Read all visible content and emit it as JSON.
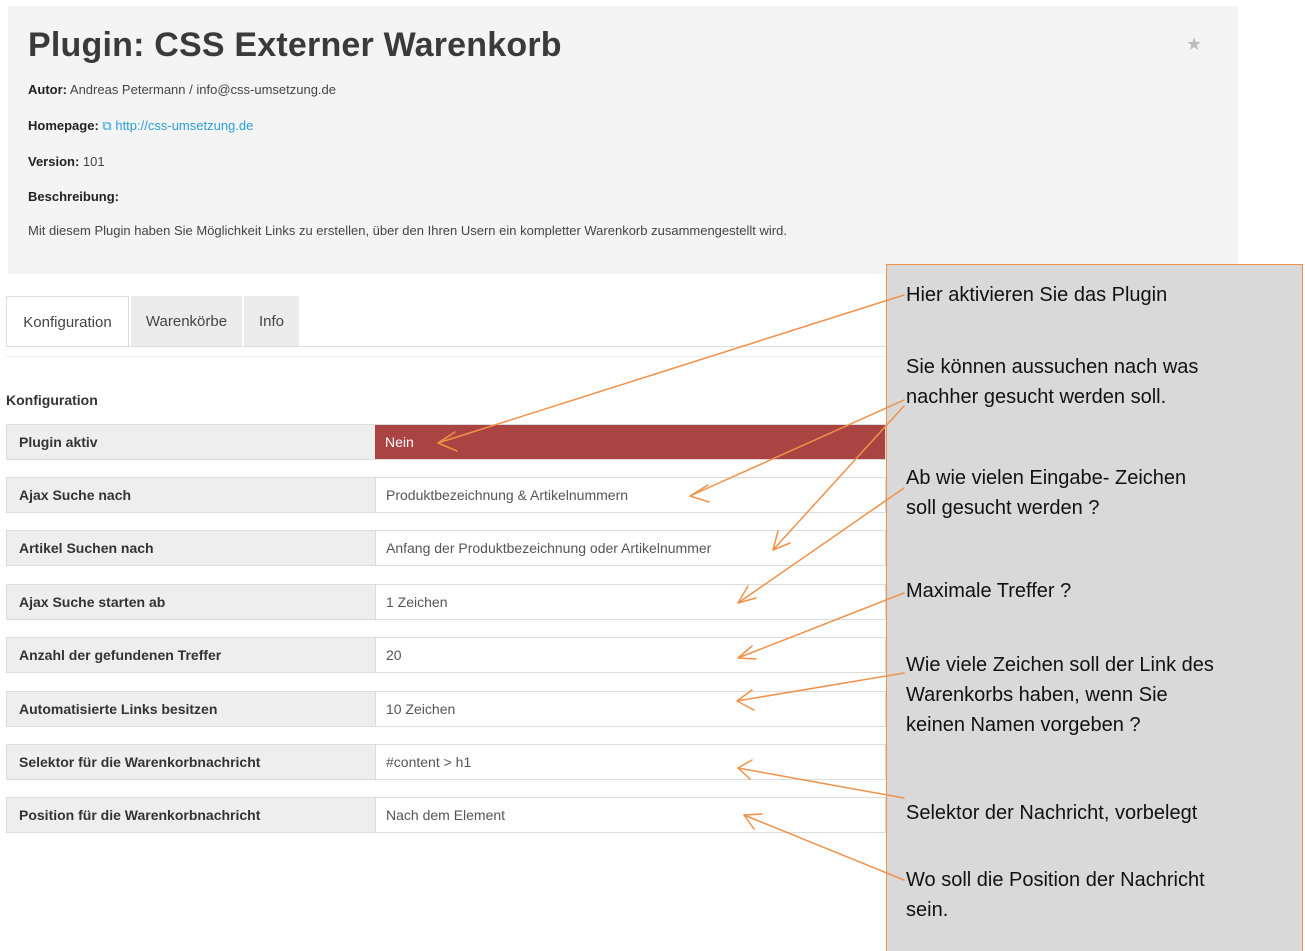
{
  "plugin": {
    "title": "Plugin: CSS Externer Warenkorb",
    "author_label": "Autor:",
    "author_value": " Andreas Petermann / info@css-umsetzung.de",
    "homepage_label": "Homepage:",
    "homepage_link": "http://css-umsetzung.de",
    "version_label": "Version:",
    "version_value": " 101",
    "description_label": "Beschreibung:",
    "description_text": "Mit diesem Plugin haben Sie Möglichkeit Links zu erstellen, über den Ihren Usern ein kompletter Warenkorb zusammengestellt wird."
  },
  "icons": {
    "star": "star-icon",
    "external_link": "external-link-icon"
  },
  "tabs": [
    {
      "label": "Konfiguration",
      "active": true
    },
    {
      "label": "Warenkörbe",
      "active": false
    },
    {
      "label": "Info",
      "active": false
    }
  ],
  "config": {
    "section_title": "Konfiguration",
    "rows": [
      {
        "label": "Plugin aktiv",
        "value": "Nein",
        "status": "danger"
      },
      {
        "label": "Ajax Suche nach",
        "value": "Produktbezeichnung & Artikelnummern"
      },
      {
        "label": "Artikel Suchen nach",
        "value": "Anfang der Produktbezeichnung oder Artikelnummer"
      },
      {
        "label": "Ajax Suche starten ab",
        "value": "1 Zeichen"
      },
      {
        "label": "Anzahl der gefundenen Treffer",
        "value": "20"
      },
      {
        "label": "Automatisierte Links besitzen",
        "value": "10 Zeichen"
      },
      {
        "label": "Selektor für die Warenkorbnachricht",
        "value": "#content > h1"
      },
      {
        "label": "Position für die Warenkorbnachricht",
        "value": "Nach dem Element"
      }
    ]
  },
  "annotations": [
    {
      "lines": [
        "Hier aktivieren Sie das Plugin"
      ]
    },
    {
      "lines": [
        "Sie können aussuchen nach was",
        "nachher gesucht werden soll."
      ]
    },
    {
      "lines": [
        "Ab wie vielen Eingabe- Zeichen",
        "soll gesucht werden ?"
      ]
    },
    {
      "lines": [
        "Maximale Treffer ?"
      ]
    },
    {
      "lines": [
        "Wie viele Zeichen soll der Link des",
        "Warenkorbs haben, wenn Sie",
        "keinen Namen vorgeben ?"
      ]
    },
    {
      "lines": [
        "Selektor der Nachricht, vorbelegt"
      ]
    },
    {
      "lines": [
        "Wo soll die Position der Nachricht",
        "sein."
      ]
    }
  ],
  "colors": {
    "danger_bg": "#a94442",
    "link": "#2a9fd6",
    "callout_bg": "#d9d9d9",
    "arrow": "#f0914a"
  }
}
